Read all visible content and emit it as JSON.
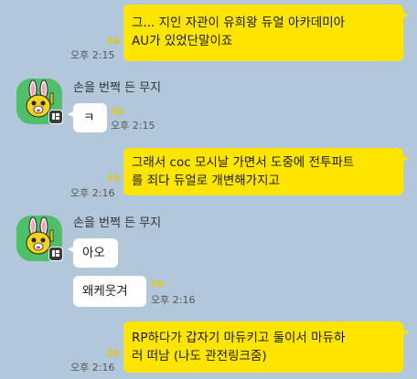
{
  "messages": [
    {
      "side": "mine",
      "lines": [
        "그... 지인 자관이 유희왕 듀얼 아카데미아",
        "AU가 있었단말이죠"
      ],
      "unread": "10",
      "time": "오후 2:15"
    },
    {
      "side": "theirs",
      "sender": "손을 번쩍 든 무지",
      "text": "ㅋ",
      "unread": "10",
      "time": "오후 2:15"
    },
    {
      "side": "mine",
      "lines": [
        "그래서 coc 모시날 가면서 도중에 전투파트",
        "를 죄다 듀얼로 개변해가지고"
      ],
      "unread": "10",
      "time": "오후 2:16"
    },
    {
      "side": "theirs",
      "sender": "손을 번쩍 든 무지",
      "text": "아오"
    },
    {
      "side": "theirs",
      "text": "왜케웃겨",
      "unread": "10",
      "time": "오후 2:16"
    },
    {
      "side": "mine",
      "lines": [
        "RP하다가 갑자기 마듀키고 둘이서 마듀하",
        "러 떠남 (나도 관전링크줌)"
      ],
      "unread": "10",
      "time": "오후 2:16"
    }
  ],
  "avatar": {
    "icon": "muzi-character-icon",
    "badge_icon": "multi-profile-badge-icon"
  },
  "colors": {
    "background": "#b2c7d9",
    "my_bubble": "#fee500",
    "their_bubble": "#ffffff",
    "unread": "#e6c700"
  }
}
